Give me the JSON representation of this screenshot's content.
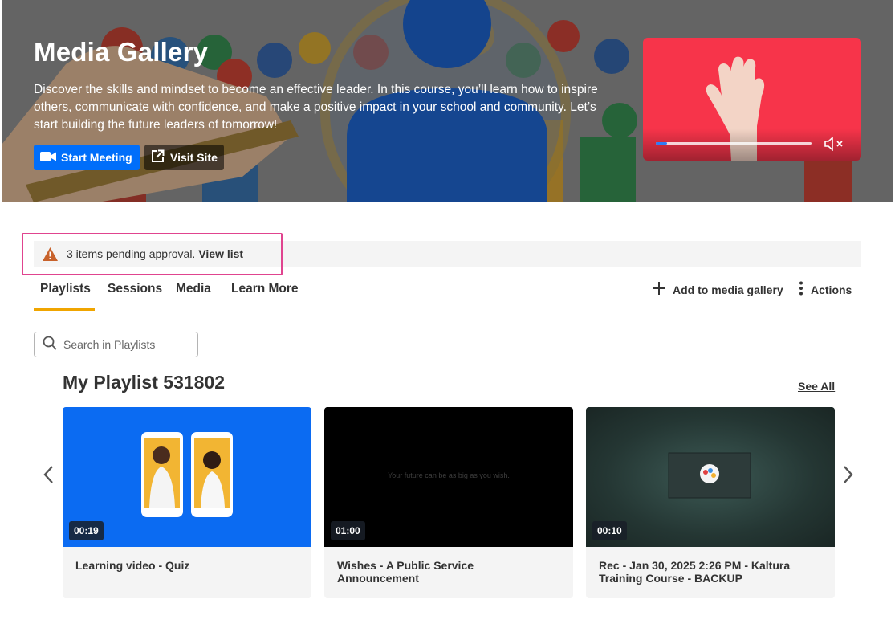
{
  "hero": {
    "title": "Media Gallery",
    "description": "Discover the skills and mindset to become an effective leader. In this course, you’ll learn how to inspire others, communicate with confidence, and make a positive impact in your school and community. Let’s start building the future leaders of tomorrow!",
    "start_meeting_label": "Start Meeting",
    "visit_site_label": "Visit Site",
    "video_progress": 0.07
  },
  "alert": {
    "message": "3 items pending approval.",
    "link_label": "View list"
  },
  "tabs": [
    {
      "label": "Playlists",
      "active": true
    },
    {
      "label": "Sessions",
      "active": false
    },
    {
      "label": "Media",
      "active": false
    },
    {
      "label": "Learn More",
      "active": false
    }
  ],
  "actions": {
    "add_label": "Add to media gallery",
    "actions_label": "Actions"
  },
  "search": {
    "placeholder": "Search in Playlists"
  },
  "playlist": {
    "title": "My Playlist 531802",
    "see_all_label": "See All",
    "items": [
      {
        "title": "Learning video - Quiz",
        "duration": "00:19"
      },
      {
        "title": "Wishes - A Public Service Announcement",
        "duration": "01:00",
        "thumb_text": "Your future can be as big as you wish."
      },
      {
        "title": "Rec - Jan 30, 2025 2:26 PM - Kaltura Training Course - BACKUP",
        "duration": "00:10"
      }
    ]
  },
  "colors": {
    "primary_button": "#006efa",
    "tab_accent": "#f0a500",
    "highlight_border": "#e0448f",
    "warning": "#c8622b",
    "hero_video_bg": "#f7344a"
  },
  "icons": [
    "video-camera-icon",
    "external-link-icon",
    "warning-icon",
    "plus-icon",
    "more-vertical-icon",
    "search-icon",
    "chevron-left-icon",
    "chevron-right-icon",
    "mute-icon"
  ]
}
